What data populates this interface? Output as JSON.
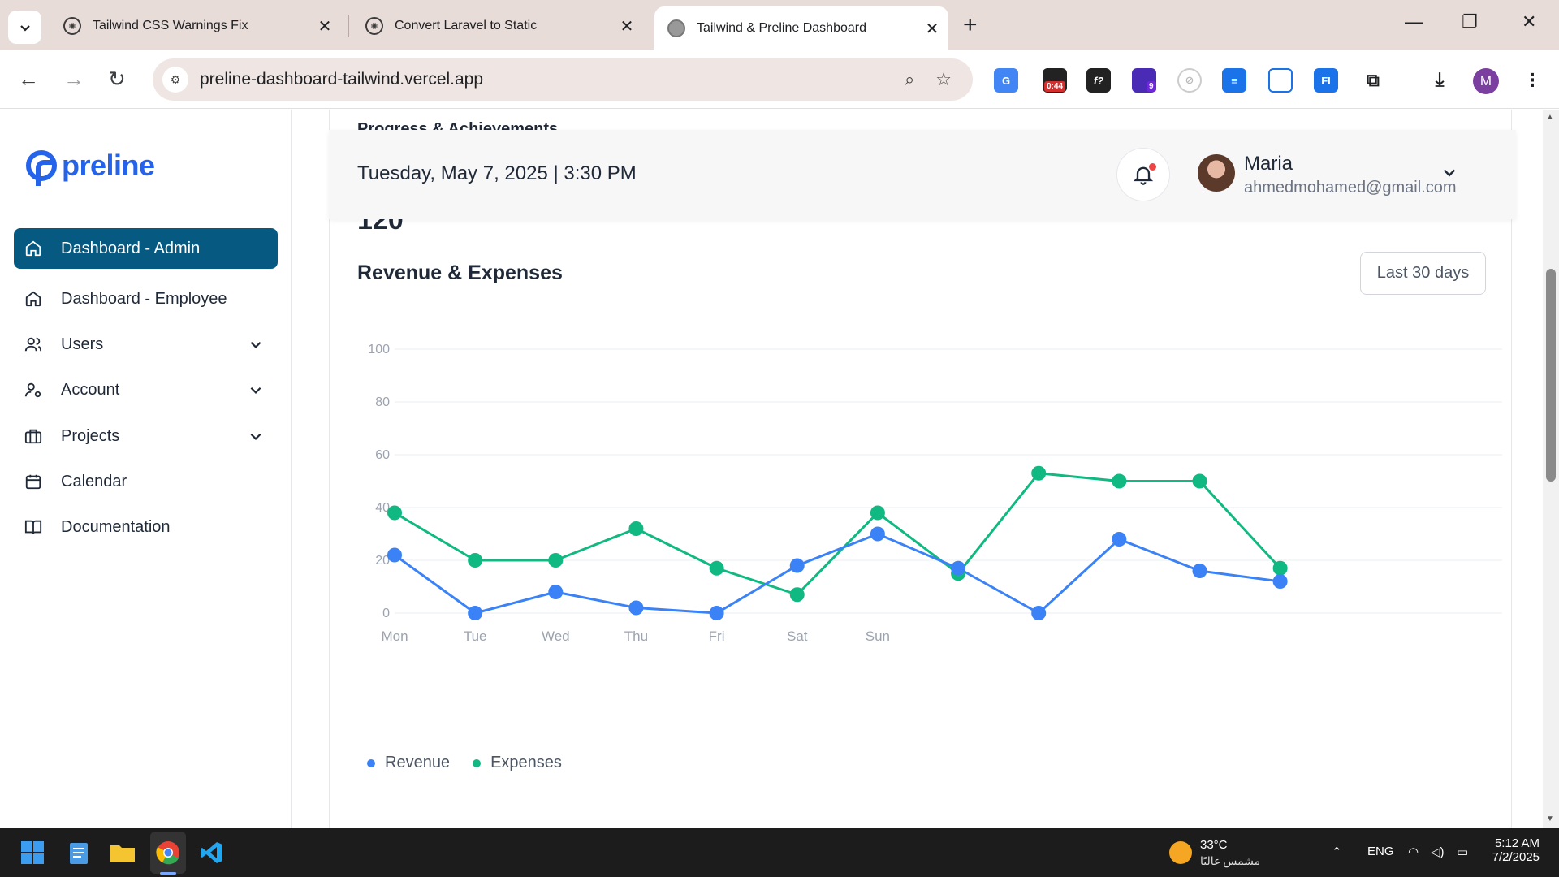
{
  "browser": {
    "tabs": [
      {
        "title": "Tailwind CSS Warnings Fix"
      },
      {
        "title": "Convert Laravel to Static"
      },
      {
        "title": "Tailwind & Preline Dashboard"
      }
    ],
    "url": "preline-dashboard-tailwind.vercel.app",
    "profile_initial": "M",
    "ext_badge_timer": "0:44",
    "ext_badge_count": "9"
  },
  "sidebar": {
    "logo": "preline",
    "items": [
      {
        "label": "Dashboard - Admin",
        "icon": "home-icon",
        "active": true
      },
      {
        "label": "Dashboard - Employee",
        "icon": "home-icon"
      },
      {
        "label": "Users",
        "icon": "users-icon",
        "has_chevron": true
      },
      {
        "label": "Account",
        "icon": "user-gear-icon",
        "has_chevron": true
      },
      {
        "label": "Projects",
        "icon": "briefcase-icon",
        "has_chevron": true
      },
      {
        "label": "Calendar",
        "icon": "calendar-icon"
      },
      {
        "label": "Documentation",
        "icon": "book-icon"
      }
    ]
  },
  "header": {
    "datetime": "Tuesday, May 7, 2025 | 3:30 PM",
    "user_name": "Maria",
    "user_email": "ahmedmohamed@gmail.com"
  },
  "peek": {
    "title": "Progress & Achievements",
    "number": "120"
  },
  "chart_card": {
    "title": "Revenue & Expenses",
    "range_button": "Last 30 days"
  },
  "chart_data": {
    "type": "line",
    "title": "Revenue & Expenses",
    "categories": [
      "Mon",
      "Tue",
      "Wed",
      "Thu",
      "Fri",
      "Sat",
      "Sun",
      "",
      "",
      "",
      "",
      ""
    ],
    "ylim": [
      0,
      100
    ],
    "yticks": [
      "0",
      "20",
      "40",
      "60",
      "80",
      "100"
    ],
    "grid": true,
    "legend": "bottom-left",
    "series": [
      {
        "name": "Revenue",
        "color": "#3b82f6",
        "values": [
          22,
          0,
          8,
          2,
          0,
          18,
          30,
          17,
          0,
          28,
          16,
          12
        ]
      },
      {
        "name": "Expenses",
        "color": "#10b981",
        "values": [
          38,
          20,
          20,
          32,
          17,
          7,
          38,
          15,
          53,
          50,
          50,
          17
        ]
      }
    ]
  },
  "taskbar": {
    "weather_temp": "33°C",
    "weather_desc": "مشمس غالبًا",
    "lang": "ENG",
    "time": "5:12 AM",
    "date": "7/2/2025"
  }
}
